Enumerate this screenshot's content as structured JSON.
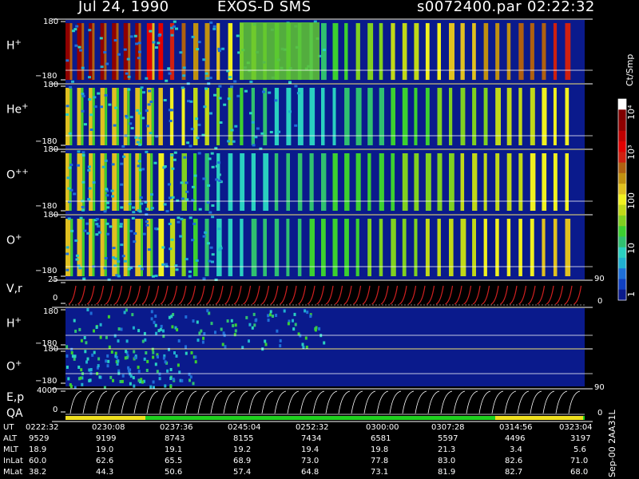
{
  "header": {
    "date": "Jul 24, 1990",
    "title": "EXOS-D SMS",
    "file": "s0072400.par",
    "time": "02:22:32"
  },
  "panels": [
    {
      "id": "hplus1",
      "label": "H",
      "sup": "+",
      "top_tick": "180",
      "bottom_tick": "−180"
    },
    {
      "id": "heplus",
      "label": "He",
      "sup": "+",
      "top_tick": "180",
      "bottom_tick": "−180"
    },
    {
      "id": "oplusplus",
      "label": "O",
      "sup": "++",
      "top_tick": "180",
      "bottom_tick": "−180"
    },
    {
      "id": "oplus1",
      "label": "O",
      "sup": "+",
      "top_tick": "180",
      "bottom_tick": "−180"
    },
    {
      "id": "vr",
      "label": "V,r",
      "sup": "",
      "top_tick": "25",
      "bottom_tick": "0",
      "right_tick": "90",
      "right_tick_low": "0"
    },
    {
      "id": "hplus2",
      "label": "H",
      "sup": "+",
      "top_tick": "180",
      "bottom_tick": "−180"
    },
    {
      "id": "oplus2",
      "label": "O",
      "sup": "+",
      "top_tick": "180",
      "bottom_tick": "−180"
    },
    {
      "id": "ep",
      "label": "E,p",
      "sup": "",
      "top_tick": "4000",
      "bottom_tick": "0",
      "right_tick": "90",
      "right_tick_low": "0"
    }
  ],
  "qa_label": "QA",
  "colorbar": {
    "unit": "Ct/Smp",
    "ticks": [
      "1",
      "10",
      "100",
      "10³",
      "10⁴"
    ],
    "colors": [
      "#0a1a8c",
      "#1040c0",
      "#1e6fd8",
      "#20b0d0",
      "#2ad0c0",
      "#30c070",
      "#3cd030",
      "#80d020",
      "#c0d818",
      "#f0f020",
      "#e0c020",
      "#c09010",
      "#b06010",
      "#d02010",
      "#e00000",
      "#c00000",
      "#900000",
      "#800000",
      "#ffffff"
    ]
  },
  "ephemeris": {
    "labels": [
      "UT",
      "ALT",
      "MLT",
      "InLat",
      "MLat"
    ],
    "ut": [
      "0222:32",
      "0230:08",
      "0237:36",
      "0245:04",
      "0252:32",
      "0300:00",
      "0307:28",
      "0314:56",
      "0323:04"
    ],
    "alt": [
      "9529",
      "9199",
      "8743",
      "8155",
      "7434",
      "6581",
      "5597",
      "4496",
      "3197"
    ],
    "mlt": [
      "18.9",
      "19.0",
      "19.1",
      "19.2",
      "19.4",
      "19.8",
      "21.3",
      "3.4",
      "5.6"
    ],
    "inlat": [
      "60.0",
      "62.6",
      "65.5",
      "68.9",
      "73.0",
      "77.8",
      "83.0",
      "82.6",
      "71.0"
    ],
    "mlat": [
      "38.2",
      "44.3",
      "50.6",
      "57.4",
      "64.8",
      "73.1",
      "81.9",
      "82.7",
      "68.0"
    ],
    "version": "Sep-00  2AA31L"
  },
  "chart_data": {
    "type": "heatmap",
    "title": "Jul 24, 1990   EXOS-D SMS",
    "xlabel": "UT",
    "x_ticks": [
      "0222:32",
      "0230:08",
      "0237:36",
      "0245:04",
      "0252:32",
      "0300:00",
      "0307:28",
      "0314:56",
      "0323:04"
    ],
    "colorbar_label": "Ct/Smp",
    "colorbar_scale": "log",
    "colorbar_range": [
      1,
      10000
    ],
    "panels": [
      {
        "name": "H+",
        "ylim": [
          -180,
          180
        ]
      },
      {
        "name": "He+",
        "ylim": [
          -180,
          180
        ]
      },
      {
        "name": "O++",
        "ylim": [
          -180,
          180
        ]
      },
      {
        "name": "O+",
        "ylim": [
          -180,
          180
        ]
      },
      {
        "name": "V,r",
        "ylim": [
          0,
          25
        ],
        "right_ylim": [
          0,
          90
        ]
      },
      {
        "name": "H+",
        "ylim": [
          -180,
          180
        ]
      },
      {
        "name": "O+",
        "ylim": [
          -180,
          180
        ]
      },
      {
        "name": "E,p",
        "ylim": [
          0,
          4000
        ],
        "right_ylim": [
          0,
          90
        ]
      }
    ]
  }
}
